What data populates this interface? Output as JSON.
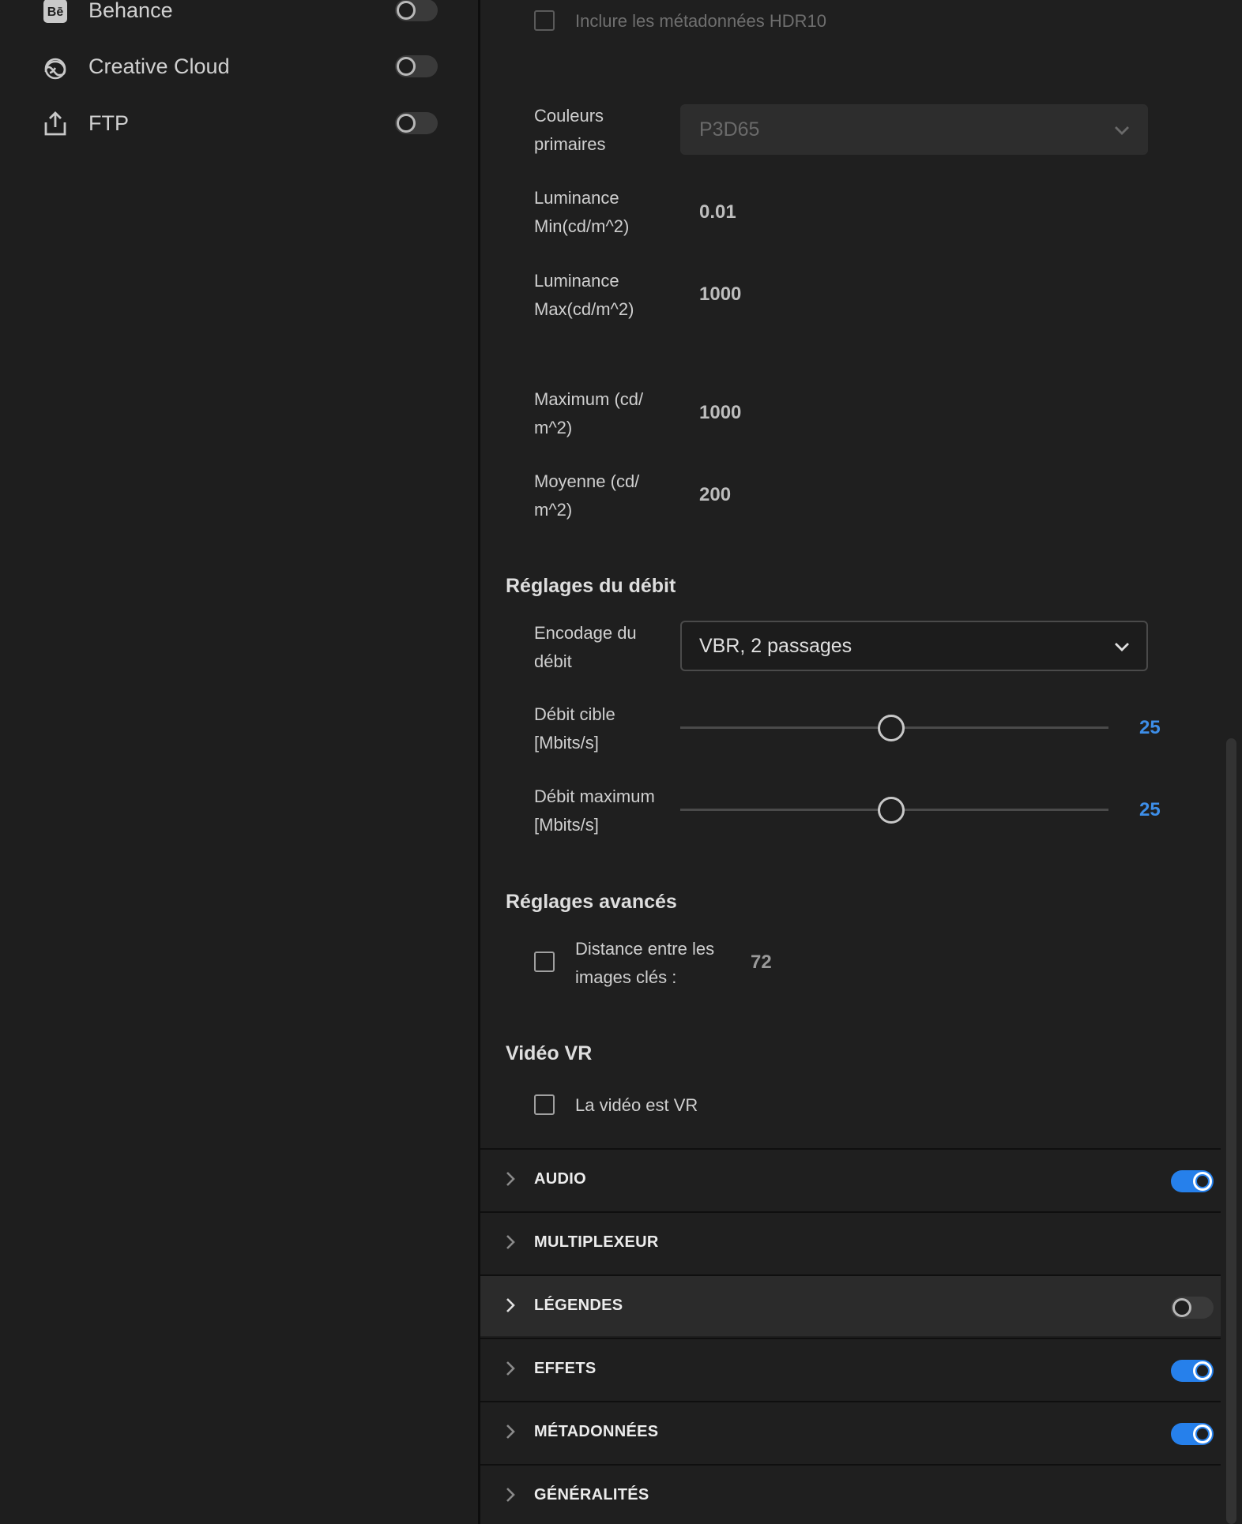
{
  "sidebar": {
    "destinations": [
      {
        "label": "Behance",
        "icon": "behance-icon",
        "enabled": false
      },
      {
        "label": "Creative Cloud",
        "icon": "creative-cloud-icon",
        "enabled": false
      },
      {
        "label": "FTP",
        "icon": "upload-icon",
        "enabled": false
      }
    ]
  },
  "hdr": {
    "include_label": "Inclure les métadonnées HDR10",
    "include_checked": false,
    "primaries_label_1": "Couleurs",
    "primaries_label_2": "primaires",
    "primaries_value": "P3D65",
    "lum_min_label_1": "Luminance",
    "lum_min_label_2": "Min(cd/m^2)",
    "lum_min_value": "0.01",
    "lum_max_label_1": "Luminance",
    "lum_max_label_2": "Max(cd/m^2)",
    "lum_max_value": "1000",
    "maximum_label_1": "Maximum (cd/",
    "maximum_label_2": "m^2)",
    "maximum_value": "1000",
    "average_label_1": "Moyenne (cd/",
    "average_label_2": "m^2)",
    "average_value": "200"
  },
  "bitrate": {
    "title": "Réglages du débit",
    "encoding_label_1": "Encodage du",
    "encoding_label_2": "débit",
    "encoding_value": "VBR, 2 passages",
    "target_label_1": "Débit cible",
    "target_label_2": "[Mbits/s]",
    "target_value": "25",
    "max_label_1": "Débit maximum",
    "max_label_2": "[Mbits/s]",
    "max_value": "25"
  },
  "advanced": {
    "title": "Réglages avancés",
    "keyframe_label_1": "Distance entre les",
    "keyframe_label_2": "images clés :",
    "keyframe_value": "72",
    "keyframe_checked": false
  },
  "vr": {
    "title": "Vidéo VR",
    "is_vr_label": "La vidéo est VR",
    "is_vr_checked": false
  },
  "sections": [
    {
      "label": "AUDIO",
      "toggle": "on"
    },
    {
      "label": "MULTIPLEXEUR",
      "toggle": "none"
    },
    {
      "label": "LÉGENDES",
      "toggle": "off"
    },
    {
      "label": "EFFETS",
      "toggle": "on"
    },
    {
      "label": "MÉTADONNÉES",
      "toggle": "on"
    },
    {
      "label": "GÉNÉRALITÉS",
      "toggle": "none"
    }
  ],
  "colors": {
    "accent": "#2680eb",
    "slider_value": "#3d8ee8"
  }
}
